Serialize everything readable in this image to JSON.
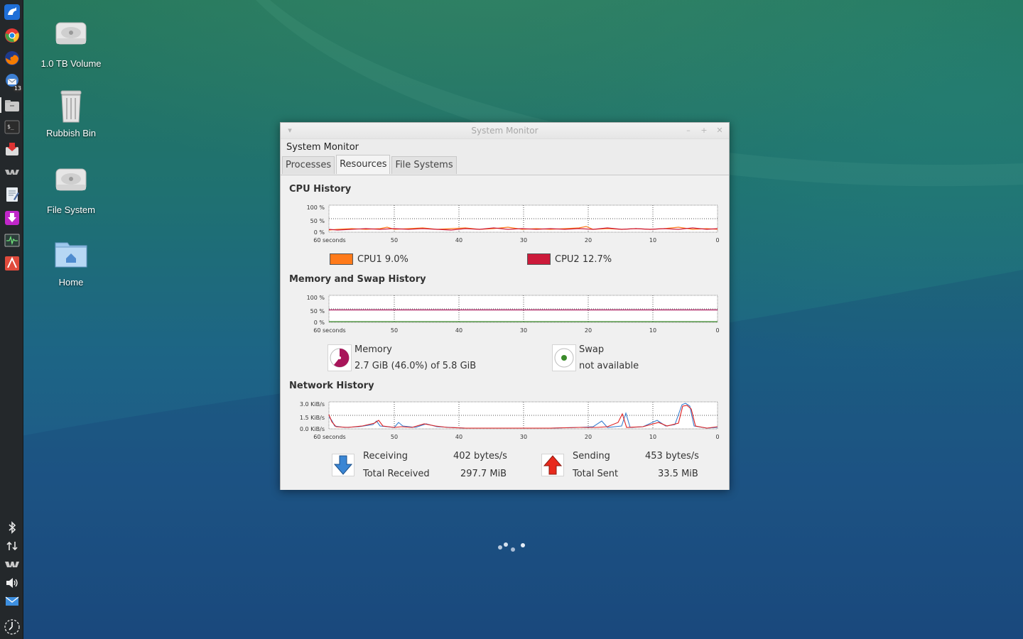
{
  "desktop": {
    "icons": [
      {
        "label": "1.0 TB Volume"
      },
      {
        "label": "Rubbish Bin"
      },
      {
        "label": "File System"
      },
      {
        "label": "Home"
      }
    ]
  },
  "dock": {
    "apps": [
      "whisker-menu",
      "chrome",
      "firefox",
      "thunderbird",
      "file-manager",
      "terminal",
      "software-center",
      "indicator",
      "text-editor",
      "downloader",
      "system-monitor",
      "presentation"
    ],
    "thunderbird_badge": "13",
    "tray": [
      "bluetooth",
      "network-transfer",
      "indicator",
      "volume",
      "mail",
      "clock"
    ]
  },
  "window": {
    "title": "System Monitor",
    "menu_title": "System Monitor",
    "tabs": [
      "Processes",
      "Resources",
      "File Systems"
    ],
    "active_tab": "Resources",
    "cpu": {
      "heading": "CPU History",
      "y_ticks": [
        "100 %",
        "50 %",
        "0 %"
      ],
      "x_ticks": [
        "60 seconds",
        "50",
        "40",
        "30",
        "20",
        "10",
        "0"
      ],
      "cpu1_label": "CPU1",
      "cpu1_value": "9.0%",
      "cpu1_color": "#ff7a1a",
      "cpu2_label": "CPU2",
      "cpu2_value": "12.7%",
      "cpu2_color": "#cc1a3a"
    },
    "memory": {
      "heading": "Memory and Swap History",
      "y_ticks": [
        "100 %",
        "50 %",
        "0 %"
      ],
      "x_ticks": [
        "60 seconds",
        "50",
        "40",
        "30",
        "20",
        "10",
        "0"
      ],
      "memory_label": "Memory",
      "memory_value": "2.7 GiB (46.0%) of 5.8 GiB",
      "memory_color": "#a8155a",
      "swap_label": "Swap",
      "swap_value": "not available",
      "swap_color": "#3a8a2a"
    },
    "network": {
      "heading": "Network History",
      "y_ticks": [
        "3.0 KiB/s",
        "1.5 KiB/s",
        "0.0 KiB/s"
      ],
      "x_ticks": [
        "60 seconds",
        "50",
        "40",
        "30",
        "20",
        "10",
        "0"
      ],
      "receiving_label": "Receiving",
      "receiving_value": "402 bytes/s",
      "total_received_label": "Total Received",
      "total_received_value": "297.7 MiB",
      "sending_label": "Sending",
      "sending_value": "453 bytes/s",
      "total_sent_label": "Total Sent",
      "total_sent_value": "33.5 MiB",
      "receive_color": "#3a7fd0",
      "send_color": "#e02020"
    }
  }
}
